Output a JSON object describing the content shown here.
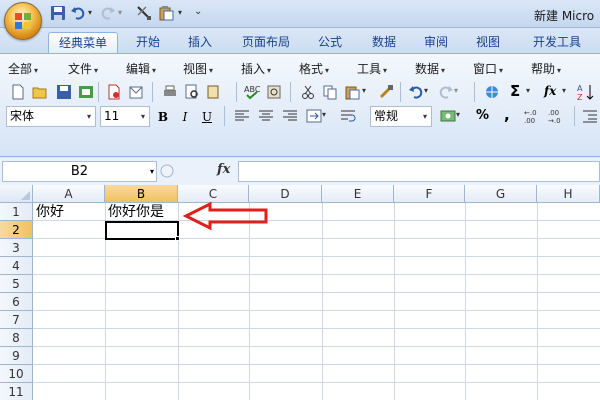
{
  "app": {
    "window_title": "新建 Micro"
  },
  "tabs": [
    {
      "label": "经典菜单",
      "active": true
    },
    {
      "label": "开始"
    },
    {
      "label": "插入"
    },
    {
      "label": "页面布局"
    },
    {
      "label": "公式"
    },
    {
      "label": "数据"
    },
    {
      "label": "审阅"
    },
    {
      "label": "视图"
    },
    {
      "label": "开发工具"
    }
  ],
  "menu": [
    {
      "label": "全部"
    },
    {
      "label": "文件"
    },
    {
      "label": "编辑"
    },
    {
      "label": "视图"
    },
    {
      "label": "插入"
    },
    {
      "label": "格式"
    },
    {
      "label": "工具"
    },
    {
      "label": "数据"
    },
    {
      "label": "窗口"
    },
    {
      "label": "帮助"
    }
  ],
  "format_bar": {
    "font_name": "宋体",
    "font_size": "11",
    "bold_label": "B",
    "italic_label": "I",
    "underline_label": "U",
    "number_format": "常规",
    "percent_label": "%",
    "comma_label": ",",
    "sum_label": "Σ",
    "fx_label": "fx"
  },
  "formula_bar": {
    "name_box": "B2",
    "fx_label": "fx",
    "formula_value": ""
  },
  "sheet": {
    "columns": [
      "A",
      "B",
      "C",
      "D",
      "E",
      "F",
      "G",
      "H"
    ],
    "rows": [
      "1",
      "2",
      "3",
      "4",
      "5",
      "6",
      "7",
      "8",
      "9",
      "10",
      "11"
    ],
    "selected_column": "B",
    "selected_row": "2",
    "cells": {
      "A1": "你好",
      "B1": "你好你是"
    }
  },
  "colors": {
    "annotation_arrow": "#e0201b",
    "ribbon_bg": "#dfe8f5",
    "header_selected": "#f1c15f"
  }
}
